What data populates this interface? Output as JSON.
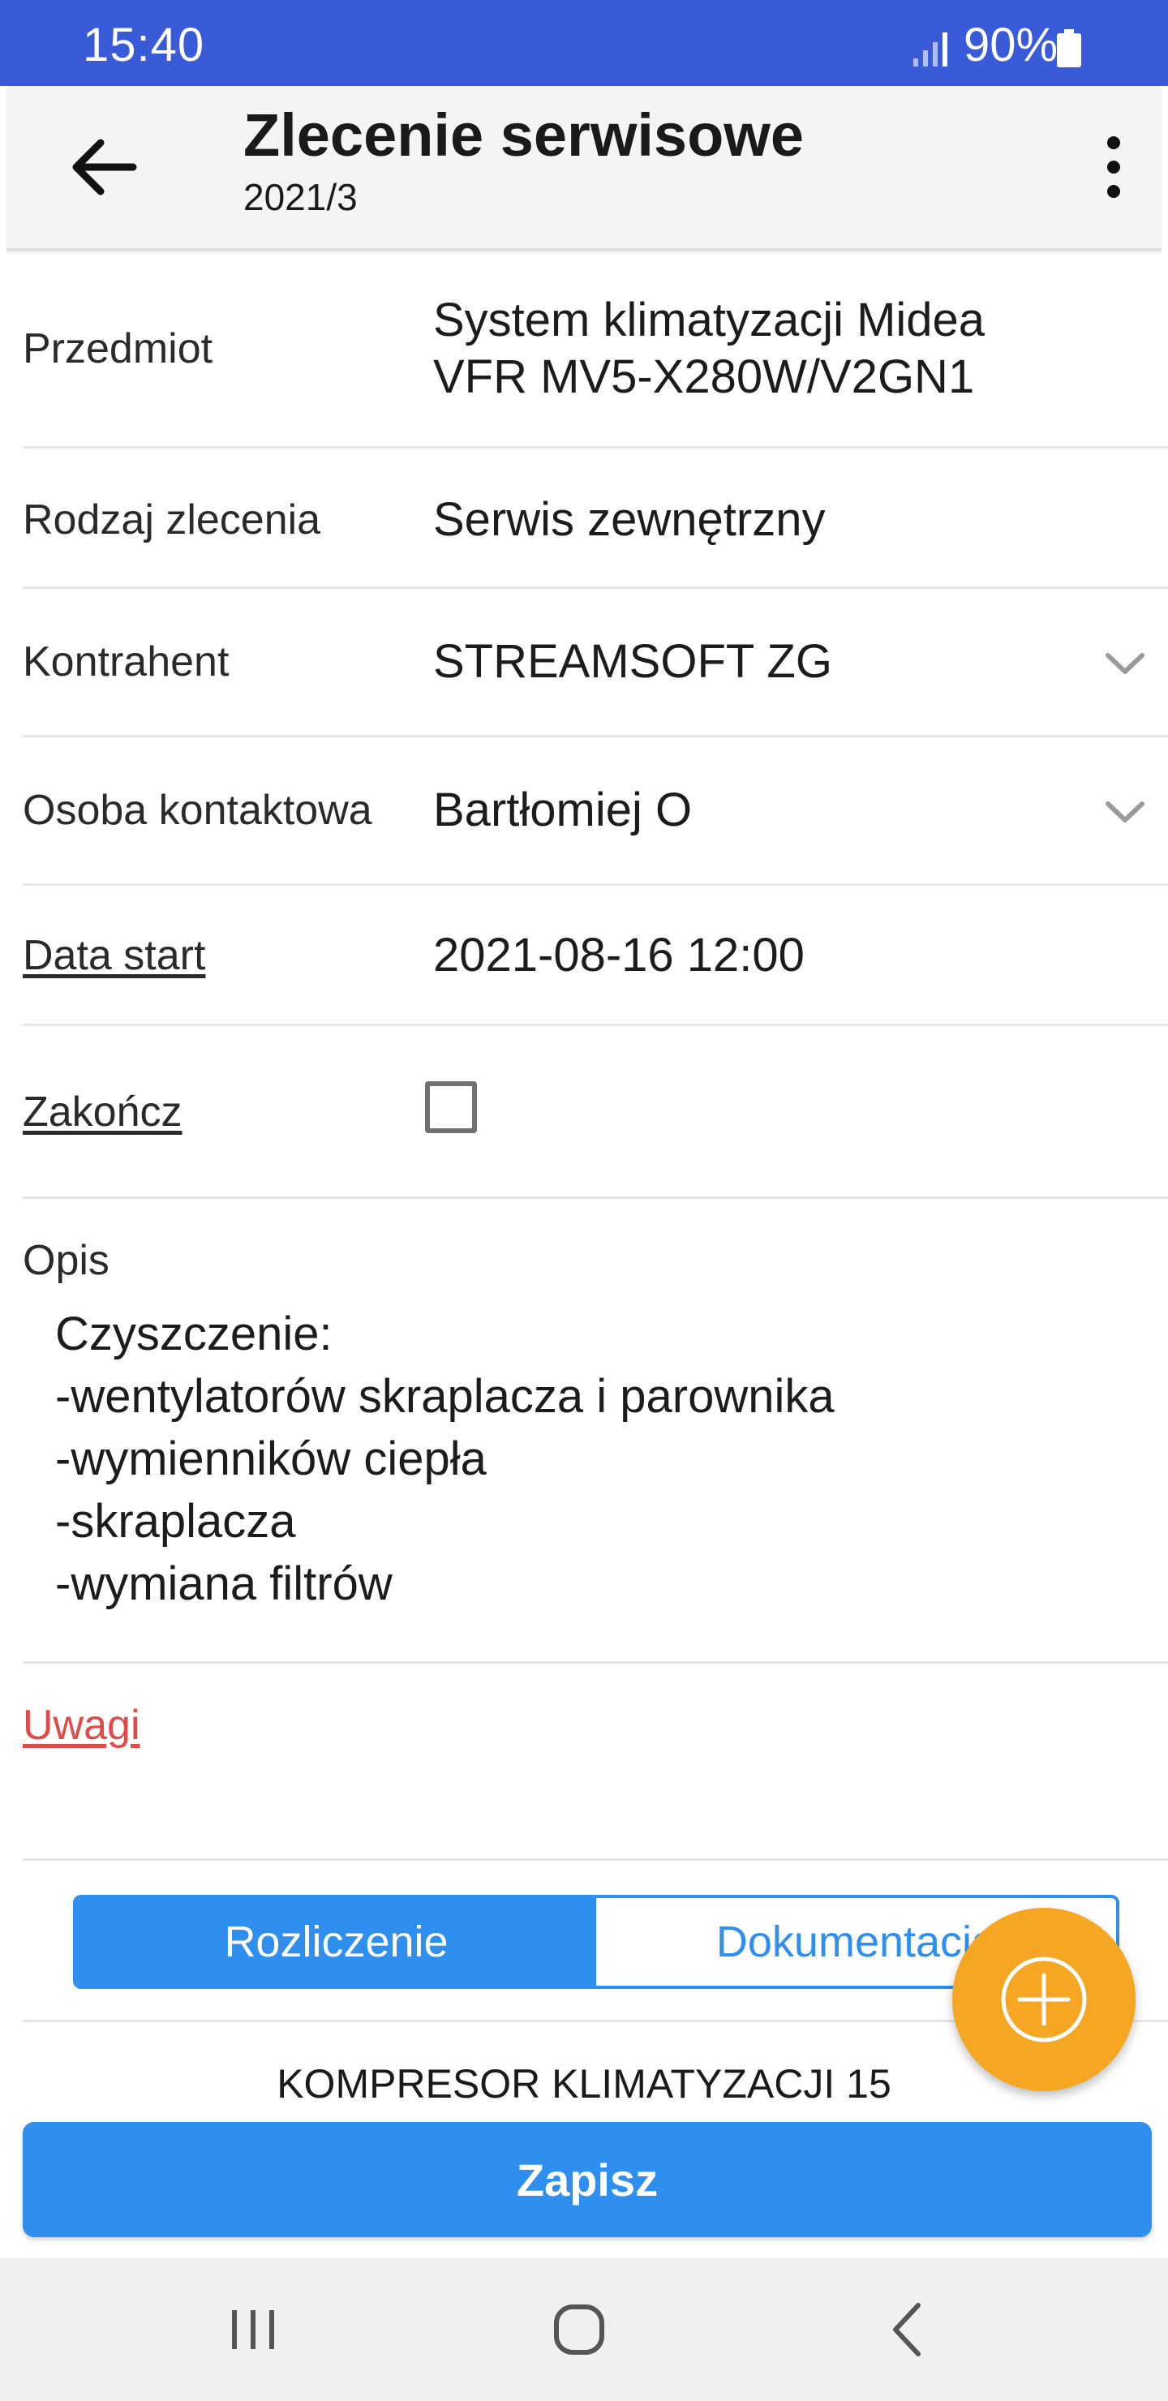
{
  "status_bar": {
    "time": "15:40",
    "battery": "90%",
    "background": "#3a5bd7",
    "icons": [
      "signal-icon",
      "battery-icon"
    ]
  },
  "app_bar": {
    "title": "Zlecenie serwisowe",
    "subtitle": "2021/3",
    "icons": [
      "back-arrow-icon",
      "more-vert-icon"
    ]
  },
  "form": {
    "subject": {
      "label": "Przedmiot",
      "value_line1": "System klimatyzacji Midea",
      "value_line2": "VFR MV5-X280W/V2GN1"
    },
    "order_type": {
      "label": "Rodzaj zlecenia",
      "value": "Serwis zewnętrzny"
    },
    "contractor": {
      "label": "Kontrahent",
      "value": "STREAMSOFT ZG"
    },
    "contact_person": {
      "label": "Osoba kontaktowa",
      "value": "Bartłomiej O"
    },
    "start_date": {
      "label": "Data start",
      "value": "2021-08-16 12:00"
    },
    "finish": {
      "label": "Zakończ",
      "checked": false
    },
    "description": {
      "label": "Opis",
      "lines": [
        "Czyszczenie:",
        "-wentylatorów skraplacza i parownika",
        "-wymienników ciepła",
        "-skraplacza",
        "-wymiana filtrów"
      ]
    },
    "notes": {
      "label": "Uwagi",
      "color": "#e24a4a"
    }
  },
  "tabs": {
    "active": "Rozliczenie",
    "inactive": "Dokumentacja",
    "accent": "#2e8fee"
  },
  "fab": {
    "icon": "add-circle-icon",
    "color": "#f5a623"
  },
  "list": {
    "first_item": "KOMPRESOR KLIMATYZACJI 15"
  },
  "save_button": {
    "label": "Zapisz",
    "color": "#2e8fee"
  },
  "nav_bar": {
    "icons": [
      "recents-icon",
      "home-icon",
      "back-icon"
    ]
  }
}
